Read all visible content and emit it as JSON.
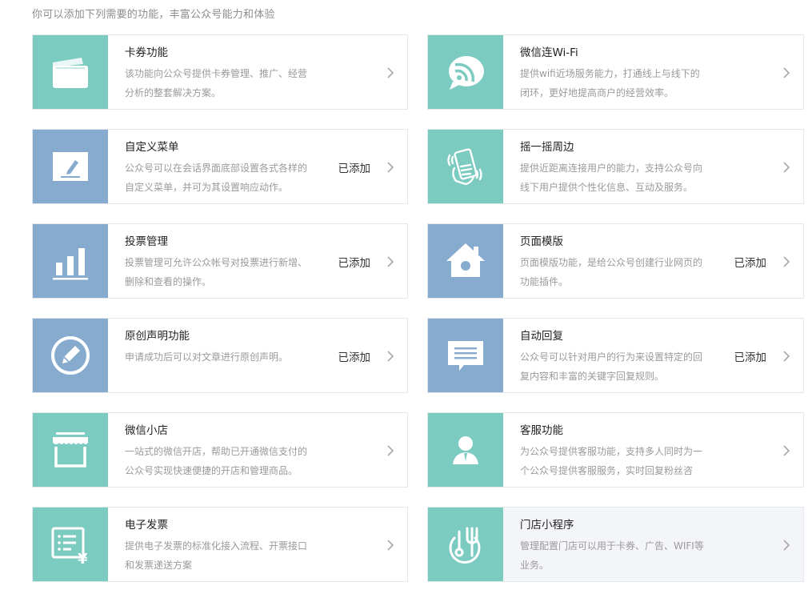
{
  "header": {
    "intro": "你可以添加下列需要的功能，丰富公众号能力和体验"
  },
  "colors": {
    "green": "#7ccbc1",
    "blue": "#87abcf",
    "border": "#e4e8eb"
  },
  "features": [
    {
      "title": "卡券功能",
      "desc": "该功能向公众号提供卡券管理、推广、经营分析的整套解决方案。",
      "status": "",
      "icon": "card-icon",
      "color": "green"
    },
    {
      "title": "微信连Wi-Fi",
      "desc": "提供wifi近场服务能力，打通线上与线下的闭环，更好地提高商户的经营效率。",
      "status": "",
      "icon": "wifi-icon",
      "color": "green"
    },
    {
      "title": "自定义菜单",
      "desc": "公众号可以在会话界面底部设置各式各样的自定义菜单，并可为其设置响应动作。",
      "status": "已添加",
      "icon": "edit-icon",
      "color": "blue"
    },
    {
      "title": "摇一摇周边",
      "desc": "提供近距离连接用户的能力，支持公众号向线下用户提供个性化信息、互动及服务。",
      "status": "",
      "icon": "shake-phone-icon",
      "color": "green"
    },
    {
      "title": "投票管理",
      "desc": "投票管理可允许公众帐号对投票进行新增、删除和查看的操作。",
      "status": "已添加",
      "icon": "bar-chart-icon",
      "color": "blue"
    },
    {
      "title": "页面模版",
      "desc": "页面模版功能，是给公众号创建行业网页的功能插件。",
      "status": "已添加",
      "icon": "home-icon",
      "color": "blue"
    },
    {
      "title": "原创声明功能",
      "desc": "申请成功后可以对文章进行原创声明。",
      "status": "已添加",
      "icon": "pencil-circle-icon",
      "color": "blue"
    },
    {
      "title": "自动回复",
      "desc": "公众号可以针对用户的行为来设置特定的回复内容和丰富的关键字回复规则。",
      "status": "已添加",
      "icon": "message-icon",
      "color": "blue"
    },
    {
      "title": "微信小店",
      "desc": "一站式的微信开店，帮助已开通微信支付的公众号实现快速便捷的开店和管理商品。",
      "status": "",
      "icon": "shop-icon",
      "color": "green"
    },
    {
      "title": "客服功能",
      "desc": "为公众号提供客服功能，支持多人同时为一个公众号提供客服服务，实时回复粉丝咨",
      "status": "",
      "icon": "customer-service-icon",
      "color": "green"
    },
    {
      "title": "电子发票",
      "desc": "提供电子发票的标准化接入流程、开票接口和发票递送方案",
      "status": "",
      "icon": "invoice-icon",
      "color": "green"
    },
    {
      "title": "门店小程序",
      "desc": "管理配置门店可以用于卡券、广告、WIFI等业务。",
      "status": "",
      "icon": "store-fork-icon",
      "color": "green",
      "highlight": true
    }
  ]
}
